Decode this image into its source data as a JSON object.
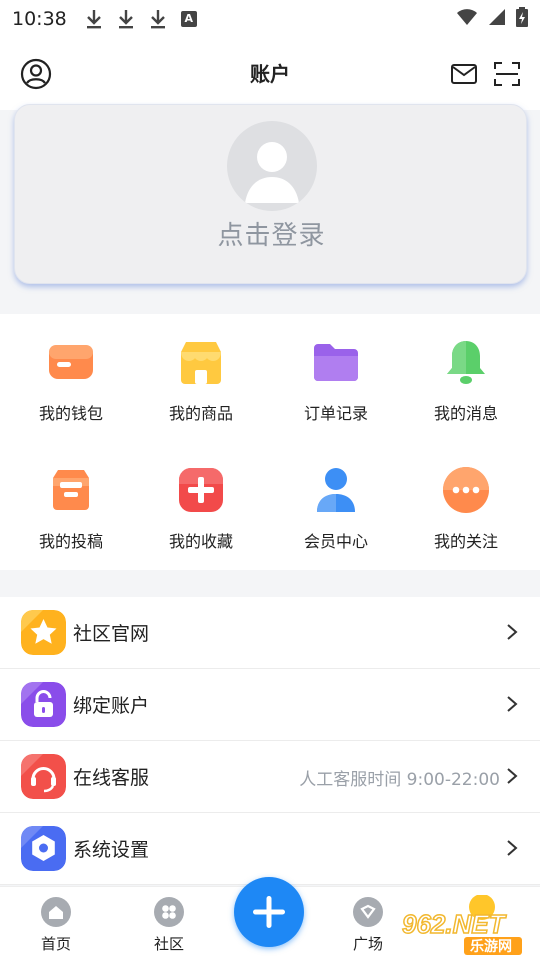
{
  "status_bar": {
    "time": "10:38",
    "badge_letter": "A"
  },
  "header": {
    "title": "账户"
  },
  "login": {
    "prompt": "点击登录"
  },
  "grid": {
    "items": [
      {
        "label": "我的钱包",
        "icon": "wallet-icon",
        "color": "#ff8a4c"
      },
      {
        "label": "我的商品",
        "icon": "shop-icon",
        "color": "#ffc940"
      },
      {
        "label": "订单记录",
        "icon": "folder-icon",
        "color": "#9a62ea"
      },
      {
        "label": "我的消息",
        "icon": "bell-icon",
        "color": "#5bcf6a"
      },
      {
        "label": "我的投稿",
        "icon": "inbox-icon",
        "color": "#ff8a4c"
      },
      {
        "label": "我的收藏",
        "icon": "plus-square-icon",
        "color": "#f24a4a"
      },
      {
        "label": "会员中心",
        "icon": "user-icon",
        "color": "#3d8ff5"
      },
      {
        "label": "我的关注",
        "icon": "more-circle-icon",
        "color": "#ff8a4c"
      }
    ]
  },
  "menu": {
    "items": [
      {
        "label": "社区官网",
        "icon": "star-icon",
        "color": "#ffb21e",
        "extra": ""
      },
      {
        "label": "绑定账户",
        "icon": "lock-icon",
        "color": "#8a4dea",
        "extra": ""
      },
      {
        "label": "在线客服",
        "icon": "headset-icon",
        "color": "#f2504a",
        "extra": "人工客服时间 9:00-22:00"
      },
      {
        "label": "系统设置",
        "icon": "settings-icon",
        "color": "#4a6cf2",
        "extra": ""
      }
    ]
  },
  "nav": {
    "home": "首页",
    "community": "社区",
    "plaza": "广场"
  },
  "watermark": {
    "main": "962.NET",
    "sub": "乐游网"
  }
}
